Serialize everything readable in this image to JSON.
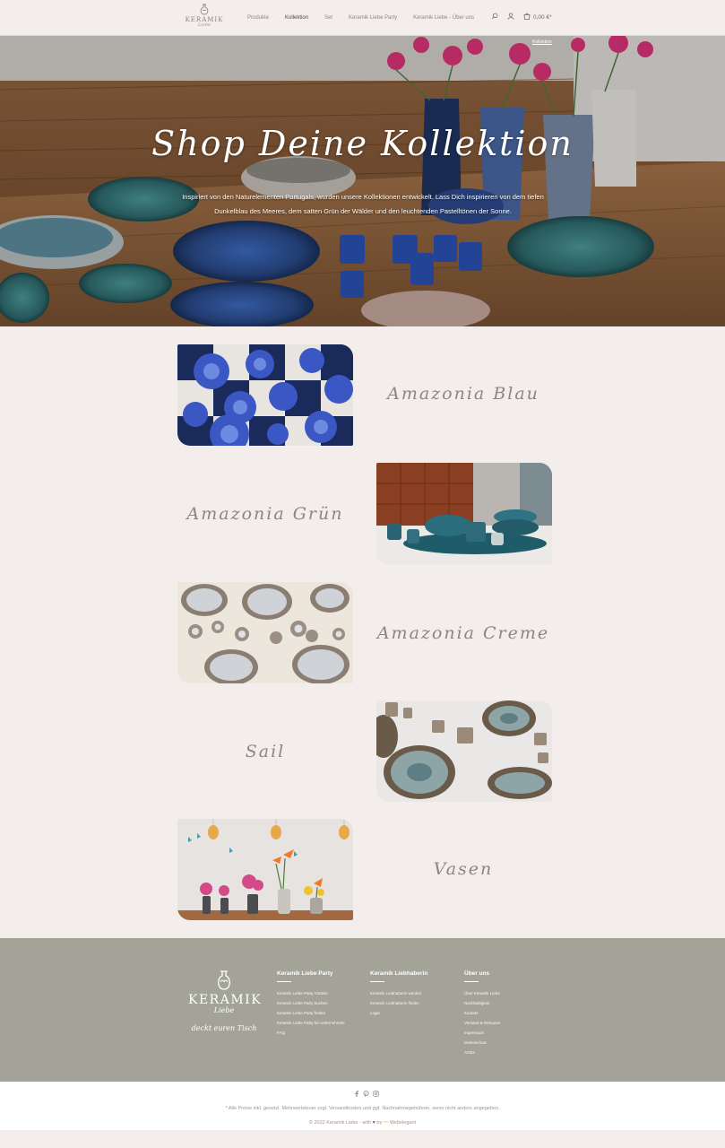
{
  "header": {
    "logo_word": "KERAMIK",
    "logo_sub": "Liebe",
    "nav": [
      "Produkte",
      "Kollektion",
      "Set",
      "Keramik Liebe Party",
      "Keramik Liebe - Über uns"
    ],
    "active_nav": "Kollektion",
    "cart_total": "0,00 €*"
  },
  "hero": {
    "title": "Shop Deine Kollektion",
    "text": "Inspiriert von den Naturelementen Portugals, wurden unsere Kollektionen entwickelt. Lass Dich inspirieren von dem tiefen Dunkelblau des Meeres, dem satten Grün der Wälder und den leuchtenden Pastelltönen der Sonne.",
    "tag": "Kollektion"
  },
  "collections": [
    {
      "name": "Amazonia Blau"
    },
    {
      "name": "Amazonia Grün"
    },
    {
      "name": "Amazonia Creme"
    },
    {
      "name": "Sail"
    },
    {
      "name": "Vasen"
    }
  ],
  "footer": {
    "logo_word": "KERAMIK",
    "logo_sub": "Liebe",
    "tagline": "deckt euren Tisch",
    "columns": [
      {
        "title": "Keramik Liebe Party",
        "links": [
          "Keramik Liebe Party Vorteile",
          "Keramik Liebe Party buchen",
          "Keramik Liebe Party finden",
          "Keramik Liebe Party für Unternehmen",
          "FAQ"
        ]
      },
      {
        "title": "Keramik Liebhaberin",
        "links": [
          "Keramik Liebhaberin werden",
          "Keramik Liebhaberin finden",
          "Login"
        ]
      },
      {
        "title": "Über uns",
        "links": [
          "Über Keramik Liebe",
          "Nachhaltigkeit",
          "Kontakt",
          "Versand & Retouren",
          "Impressum",
          "Datenschutz",
          "AGBs"
        ]
      }
    ]
  },
  "bottom": {
    "social_icons": [
      "facebook-icon",
      "pinterest-icon",
      "instagram-icon"
    ],
    "legal": "* Alle Preise inkl. gesetzl. Mehrwertsteuer zzgl. Versandkosten und ggf. Nachnahmegebühren, wenn nicht anders angegeben.",
    "copyright_prefix": "© 2022 Keramik Liebe - with",
    "copyright_by": "by",
    "copyright_brand": "Webelegant"
  },
  "colors": {
    "background": "#f3eeeb",
    "footer": "#a3a397",
    "text": "#8b8682"
  }
}
